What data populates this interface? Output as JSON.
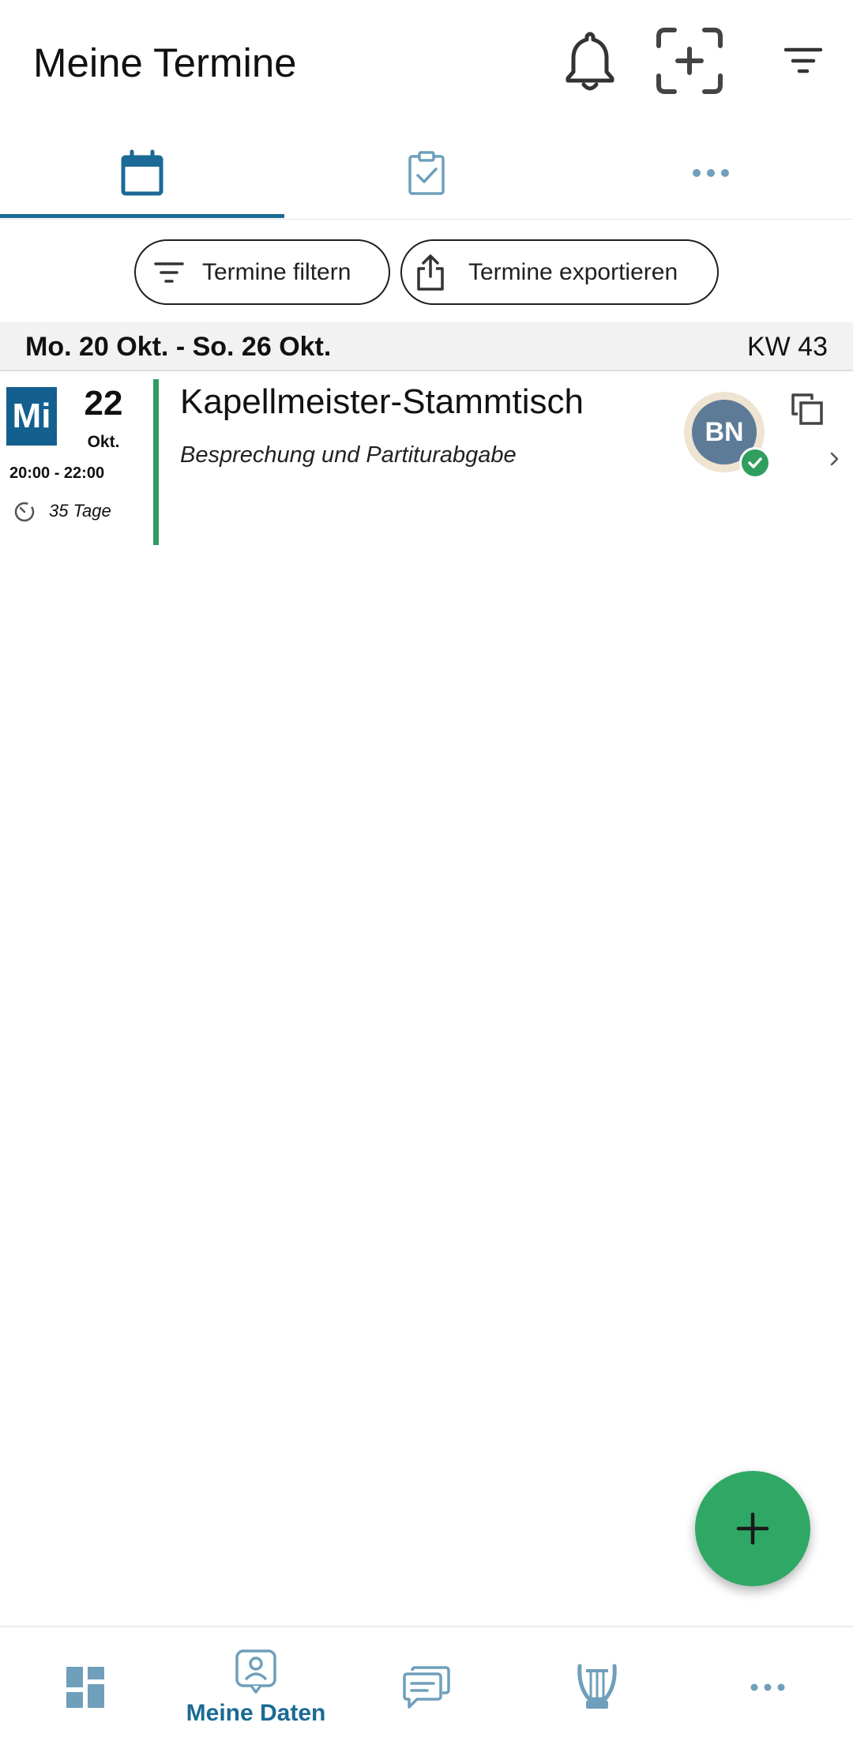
{
  "app_bar": {
    "title": "Meine Termine",
    "icons": [
      "bell-icon",
      "add-scan-icon",
      "filter-icon"
    ]
  },
  "tabs": [
    {
      "icon": "calendar-icon",
      "active": true
    },
    {
      "icon": "clipboard-check-icon",
      "active": false
    },
    {
      "icon": "more-horizontal-icon",
      "active": false
    }
  ],
  "chips": {
    "filter_label": "Termine filtern",
    "export_label": "Termine exportieren"
  },
  "week": {
    "range": "Mo. 20 Okt. - So. 26 Okt.",
    "kw": "KW 43"
  },
  "event": {
    "weekday": "Mi",
    "day": "22",
    "month": "Okt.",
    "time": "20:00 - 22:00",
    "countdown": "35 Tage",
    "title": "Kapellmeister-Stammtisch",
    "subtitle": "Besprechung und Partiturabgabe",
    "avatar_initials": "BN"
  },
  "bottom_nav": {
    "items": [
      {
        "icon": "dashboard-icon",
        "label": ""
      },
      {
        "icon": "profile-card-icon",
        "label": "Meine Daten",
        "active": true
      },
      {
        "icon": "chat-icon",
        "label": ""
      },
      {
        "icon": "lyre-icon",
        "label": ""
      },
      {
        "icon": "more-horizontal-icon",
        "label": ""
      }
    ]
  },
  "colors": {
    "primary": "#1a6a95",
    "badge": "#135f8e",
    "accent_green": "#2f9e5f",
    "fab": "#2fa866",
    "avatar": "#5d7b97"
  }
}
